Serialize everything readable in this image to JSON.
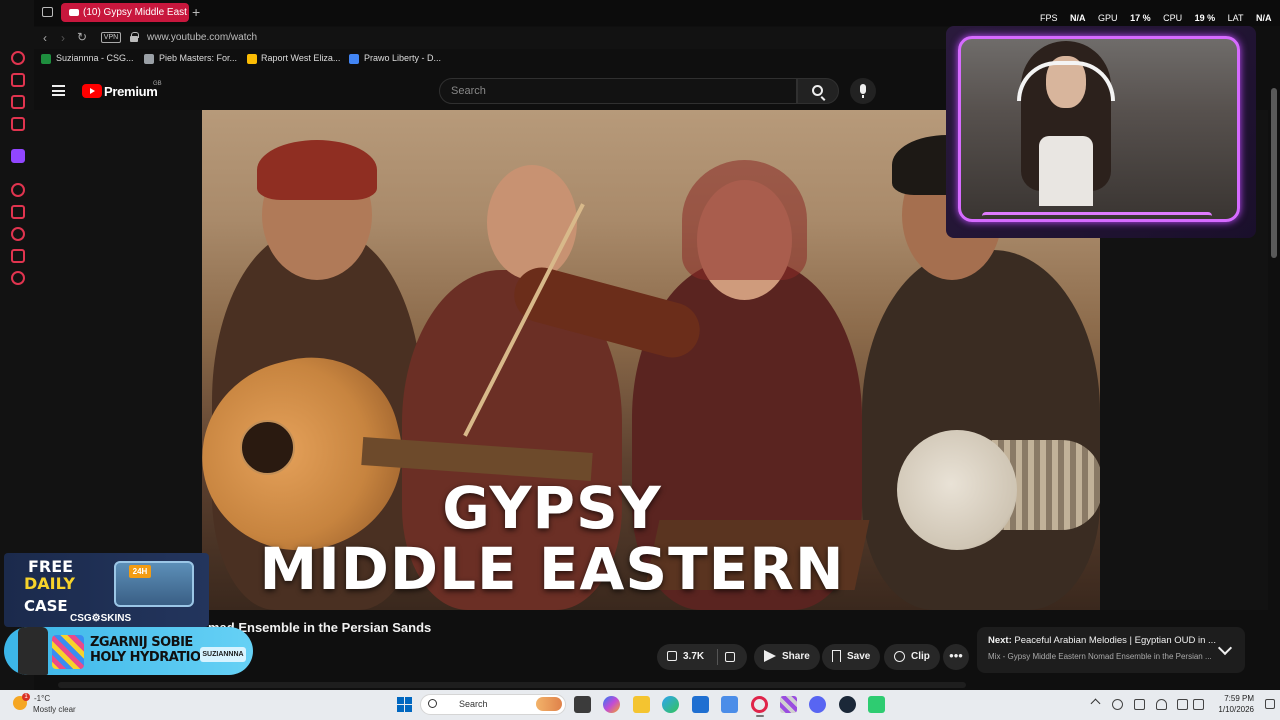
{
  "browser": {
    "active_tab_title": "(10) Gypsy Middle East",
    "url": "www.youtube.com/watch",
    "vpn_label": "VPN",
    "new_tab": "+",
    "bookmarks": [
      {
        "label": "Suziannna - CSG...",
        "icon": "sheets-icon",
        "color": "#1e8e3e"
      },
      {
        "label": "Pieb Masters: For...",
        "icon": "wrench-icon",
        "color": "#9aa0a6"
      },
      {
        "label": "Raport West Eliza...",
        "icon": "drive-icon",
        "color": "#fbbc04"
      },
      {
        "label": "Prawo Liberty - D...",
        "icon": "docs-icon",
        "color": "#4285f4"
      }
    ]
  },
  "youtube": {
    "logo_text": "Premium",
    "country_code": "GB",
    "search_placeholder": "Search",
    "video_title": "mad Ensemble in the Persian Sands",
    "thumbnail_line1": "GYPSY",
    "thumbnail_line2": "MIDDLE EASTERN",
    "likes": "3.7K",
    "share_label": "Share",
    "save_label": "Save",
    "clip_label": "Clip",
    "more_label": "•••",
    "next_prefix": "Next:",
    "next_title": "Peaceful Arabian Melodies | Egyptian OUD in ...",
    "next_subtitle": "Mix - Gypsy Middle Eastern Nomad Ensemble in the Persian ..."
  },
  "stream_overlay": {
    "stats": [
      {
        "label": "FPS",
        "value": "N/A"
      },
      {
        "label": "GPU",
        "value": "17 %"
      },
      {
        "label": "CPU",
        "value": "19 %"
      },
      {
        "label": "LAT",
        "value": "N/A"
      }
    ],
    "ad_csgo": {
      "line1": "FREE",
      "line2": "DAILY",
      "line3": "CASE",
      "badge": "24H",
      "brand": "CSG⚙SKINS"
    },
    "ad_hydration": {
      "line1": "ZGARNIJ SOBIE",
      "line2": "HOLY HYDRATION",
      "tag": "SUZIANNNA"
    },
    "accent_color": "#d66bff"
  },
  "taskbar": {
    "weather_badge": "1",
    "weather_temp": "-1°C",
    "weather_desc": "Mostly clear",
    "search_placeholder": "Search",
    "time": "7:59 PM",
    "date": "1/10/2026"
  }
}
